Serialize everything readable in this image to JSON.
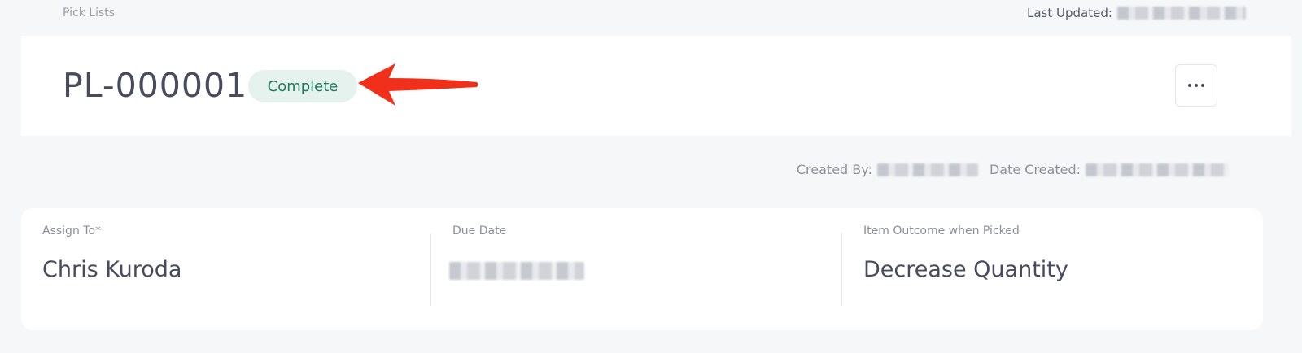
{
  "breadcrumb": {
    "label": "Pick Lists"
  },
  "top_bar": {
    "last_updated_label": "Last Updated:"
  },
  "header": {
    "title": "PL-000001",
    "status": "Complete",
    "more_icon": "more-horizontal-icon"
  },
  "meta": {
    "created_by_label": "Created By:",
    "date_created_label": "Date Created:"
  },
  "details": {
    "fields": [
      {
        "label": "Assign To*",
        "value": "Chris Kuroda"
      },
      {
        "label": "Due Date",
        "value": ""
      },
      {
        "label": "Item Outcome when Picked",
        "value": "Decrease Quantity"
      }
    ]
  },
  "colors": {
    "status_bg": "#e6f2ee",
    "status_text": "#1f7a5a",
    "arrow": "#f1301c"
  }
}
